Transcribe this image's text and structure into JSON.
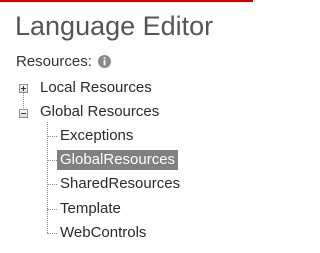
{
  "header": {
    "title": "Language Editor"
  },
  "resources": {
    "label": "Resources:",
    "info_icon": "info-icon"
  },
  "tree": {
    "local": {
      "label": "Local Resources",
      "expander_icon": "plus-icon",
      "expanded": false
    },
    "global": {
      "label": "Global Resources",
      "expander_icon": "minus-icon",
      "expanded": true,
      "children": [
        {
          "label": "Exceptions",
          "selected": false
        },
        {
          "label": "GlobalResources",
          "selected": true
        },
        {
          "label": "SharedResources",
          "selected": false
        },
        {
          "label": "Template",
          "selected": false
        },
        {
          "label": "WebControls",
          "selected": false
        }
      ]
    }
  },
  "colors": {
    "accent": "#cc0000",
    "selection_bg": "#808080",
    "selection_text": "#ffffff"
  }
}
